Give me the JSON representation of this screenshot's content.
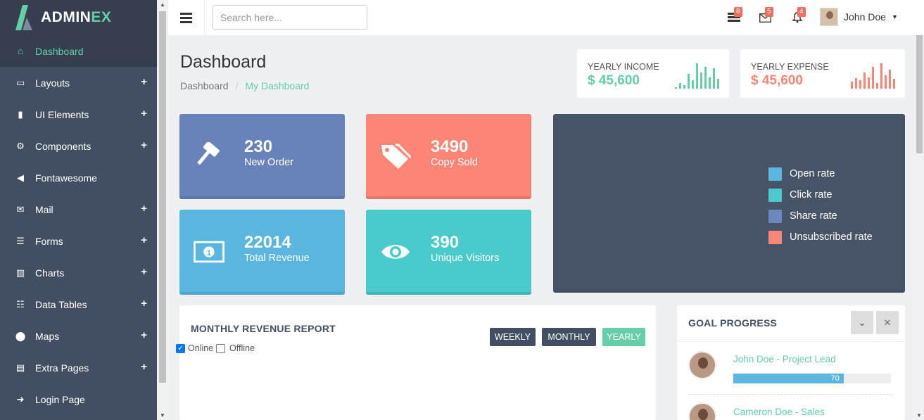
{
  "app": {
    "brand_main": "ADMIN",
    "brand_accent": "EX"
  },
  "sidebar": {
    "items": [
      {
        "label": "Dashboard",
        "icon": "home-icon",
        "active": true,
        "expandable": false
      },
      {
        "label": "Layouts",
        "icon": "laptop-icon",
        "expandable": true
      },
      {
        "label": "UI Elements",
        "icon": "book-icon",
        "expandable": true
      },
      {
        "label": "Components",
        "icon": "gears-icon",
        "expandable": true
      },
      {
        "label": "Fontawesome",
        "icon": "bullhorn-icon",
        "expandable": false
      },
      {
        "label": "Mail",
        "icon": "envelope-icon",
        "expandable": true
      },
      {
        "label": "Forms",
        "icon": "tasks-icon",
        "expandable": true
      },
      {
        "label": "Charts",
        "icon": "bar-chart-icon",
        "expandable": true
      },
      {
        "label": "Data Tables",
        "icon": "th-list-icon",
        "expandable": true
      },
      {
        "label": "Maps",
        "icon": "map-marker-icon",
        "expandable": true
      },
      {
        "label": "Extra Pages",
        "icon": "file-icon",
        "expandable": true
      },
      {
        "label": "Login Page",
        "icon": "sign-in-icon",
        "expandable": false
      }
    ],
    "expand_symbol": "+"
  },
  "header": {
    "search_placeholder": "Search here...",
    "tasks_count": "8",
    "mail_count": "5",
    "notifications_count": "4",
    "user_name": "John Doe"
  },
  "page": {
    "title": "Dashboard",
    "breadcrumb": [
      "Dashboard",
      "My Dashboard"
    ],
    "breadcrumb_sep": "/"
  },
  "yearly_income": {
    "label": "YEARLY INCOME",
    "value": "$ 45,600",
    "color": "#65cea7",
    "spark": [
      2,
      8,
      5,
      20,
      12,
      35,
      22,
      30,
      16,
      28,
      14
    ]
  },
  "yearly_expense": {
    "label": "YEARLY EXPENSE",
    "value": "$ 45,600",
    "color": "#fc8675",
    "spark": [
      10,
      15,
      12,
      22,
      16,
      30,
      8,
      35,
      18,
      26,
      14
    ]
  },
  "tiles": [
    {
      "value": "230",
      "label": "New Order",
      "icon": "gavel-icon",
      "color": "#6883ba",
      "shade": "#5c77ad"
    },
    {
      "value": "3490",
      "label": "Copy Sold",
      "icon": "tags-icon",
      "color": "#fc8675",
      "shade": "#e7766a"
    },
    {
      "value": "22014",
      "label": "Total Revenue",
      "icon": "money-icon",
      "color": "#5ab6df",
      "shade": "#4ea5cd"
    },
    {
      "value": "390",
      "label": "Unique Visitors",
      "icon": "eye-icon",
      "color": "#4acacb",
      "shade": "#3fb5b6"
    }
  ],
  "chart_legend": [
    {
      "label": "Open rate",
      "color": "#5ab6df"
    },
    {
      "label": "Click rate",
      "color": "#4acacb"
    },
    {
      "label": "Share rate",
      "color": "#6a8abe"
    },
    {
      "label": "Unsubscribed rate",
      "color": "#fc8675"
    }
  ],
  "revenue_report": {
    "title": "MONTHLY REVENUE REPORT",
    "online_label": "Online",
    "offline_label": "Offline",
    "online_checked": true,
    "offline_checked": false,
    "buttons": [
      {
        "label": "WEEKLY",
        "color": "#424f63"
      },
      {
        "label": "MONTHLY",
        "color": "#424f63"
      },
      {
        "label": "YEARLY",
        "color": "#65cea7"
      }
    ]
  },
  "goal_progress": {
    "title": "GOAL PROGRESS",
    "members": [
      {
        "name": "John Doe - Project Lead",
        "progress_text": "70",
        "progress": 0.7
      },
      {
        "name": "Cameron Doe - Sales"
      }
    ]
  }
}
